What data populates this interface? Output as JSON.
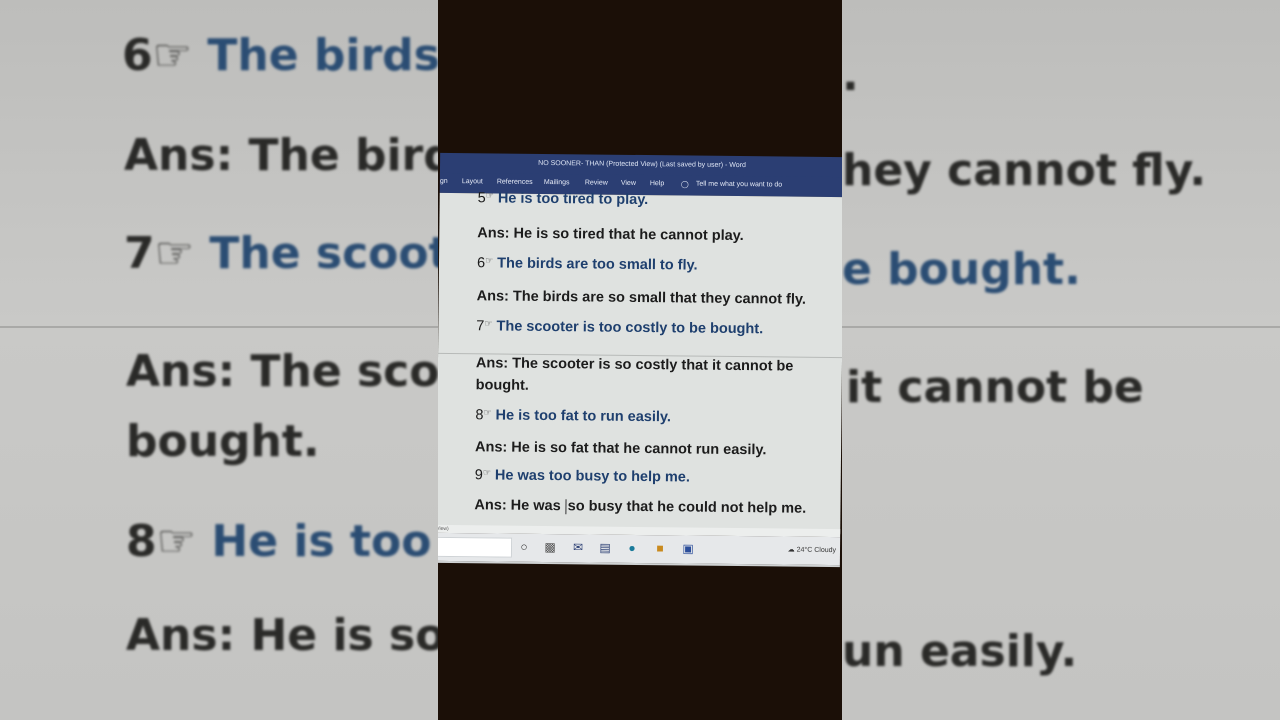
{
  "background": {
    "lines": [
      {
        "num": "6☞",
        "text": "The birds a",
        "trail": "."
      },
      {
        "num": "",
        "text": "Ans: The birds",
        "trail": "hey cannot fly."
      },
      {
        "num": "7☞",
        "text": "The scoote",
        "trail": "e bought."
      },
      {
        "num": "",
        "text": "Ans: The scoot",
        "trail": "it cannot be"
      },
      {
        "num": "",
        "text": "bought.",
        "trail": ""
      },
      {
        "num": "8☞",
        "text": "He is too f",
        "trail": ""
      },
      {
        "num": "",
        "text": "Ans: He is so fa",
        "trail": "un easily."
      }
    ]
  },
  "word": {
    "title": "NO SOONER- THAN (Protected View) (Last saved by user)  -  Word",
    "tabs": [
      "gn",
      "Layout",
      "References",
      "Mailings",
      "Review",
      "View",
      "Help"
    ],
    "tell_me": "Tell me what you want to do",
    "status": "View)",
    "weather": "24°C  Cloudy"
  },
  "document": {
    "items": [
      {
        "num": "5",
        "q": "He is too tired to play.",
        "a": "Ans: He is so tired that he cannot play."
      },
      {
        "num": "6",
        "q": "The birds are too small to fly.",
        "a": "Ans: The birds are so small that they cannot fly."
      },
      {
        "num": "7",
        "q": "The scooter is too costly to be bought.",
        "a1": "Ans: The scooter is so costly that it cannot be",
        "a2": "bought."
      },
      {
        "num": "8",
        "q": "He is too fat to run easily.",
        "a": "Ans: He is so fat that he cannot run easily."
      },
      {
        "num": "9",
        "q": "He was too busy to help me.",
        "a_pre": "Ans: He was ",
        "a_post": "so busy that he could not help me."
      }
    ],
    "hand_symbol": "☞"
  }
}
